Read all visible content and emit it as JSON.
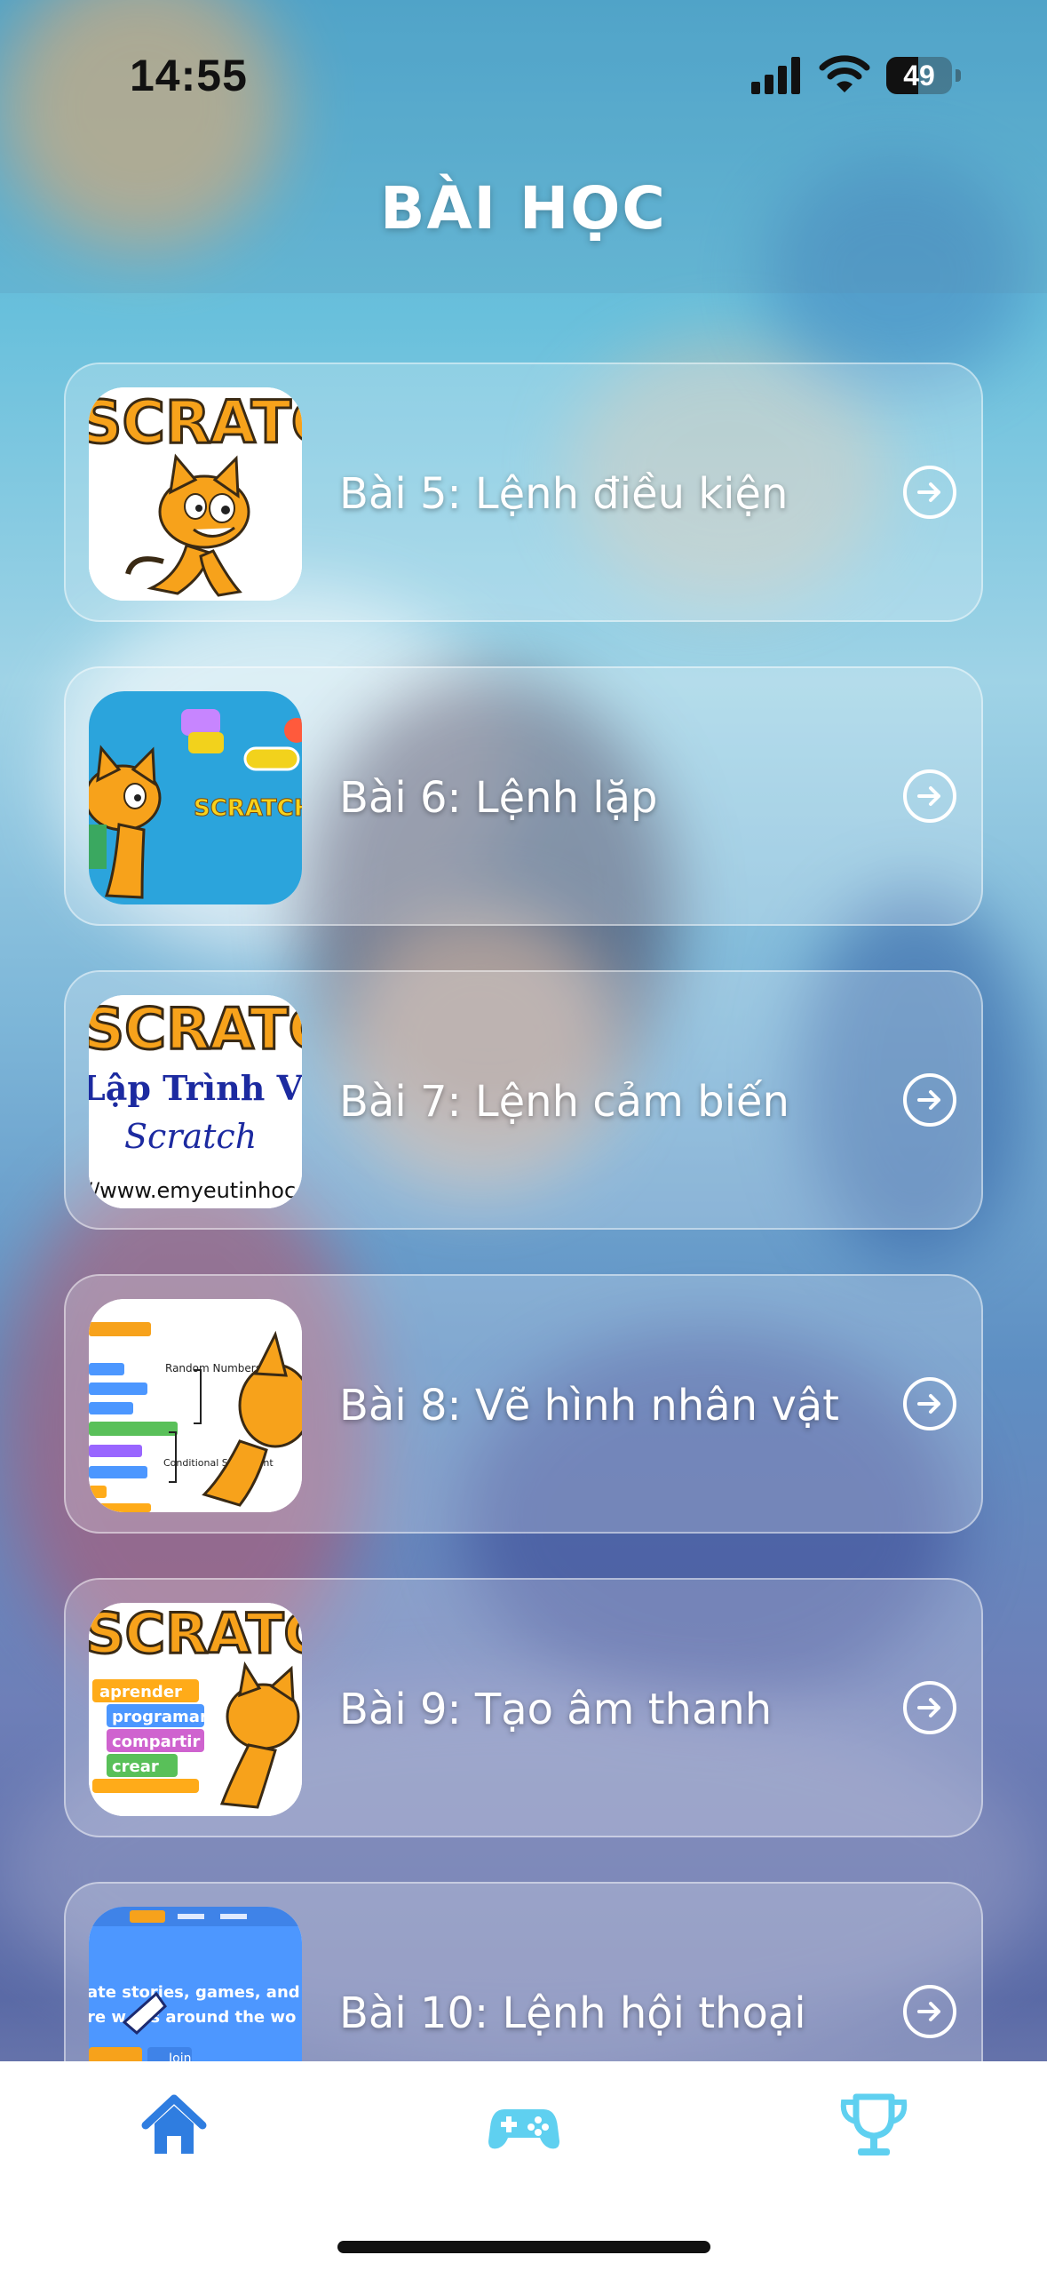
{
  "status_bar": {
    "time": "14:55",
    "battery_level": "49",
    "icons": [
      "cellular-signal-icon",
      "wifi-icon",
      "battery-icon"
    ]
  },
  "header": {
    "title": "BÀI HỌC"
  },
  "lessons": [
    {
      "label": "Bài 5: Lệnh điều kiện",
      "thumbnail": "scratch-cat-logo"
    },
    {
      "label": "Bài 6: Lệnh lặp",
      "thumbnail": "scratch-cat-blue"
    },
    {
      "label": "Bài 7: Lệnh cảm biến",
      "thumbnail": "scratch-lap-trinh"
    },
    {
      "label": "Bài 8: Vẽ hình nhân vật",
      "thumbnail": "scratch-blocks-diagram"
    },
    {
      "label": "Bài 9: Tạo âm thanh",
      "thumbnail": "scratch-aprender"
    },
    {
      "label": "Bài 10: Lệnh hội thoại",
      "thumbnail": "scratch-website"
    }
  ],
  "thumb_text": {
    "scratch": "SCRATCH",
    "lap_trinh": "Lập Trình Với",
    "scratch_script": "Scratch",
    "url": "//www.emyeutinhoc",
    "random_numbers": "Random Numbers",
    "conditional_statement": "Conditional Statement",
    "aprender": "aprender",
    "programar": "programar",
    "compartir": "compartir",
    "crear": "crear",
    "web_line1": "ate stories, games, and anim",
    "web_line2": "re w  ers around the wo",
    "join": "Join"
  },
  "tabbar": {
    "tabs": [
      {
        "name": "home",
        "icon": "home-icon",
        "active": true
      },
      {
        "name": "games",
        "icon": "gamepad-icon",
        "active": false
      },
      {
        "name": "achievements",
        "icon": "trophy-icon",
        "active": false
      }
    ]
  },
  "colors": {
    "tab_active": "#2f7de0",
    "tab_inactive": "#5fd0f0",
    "card_text": "#ffffff"
  }
}
